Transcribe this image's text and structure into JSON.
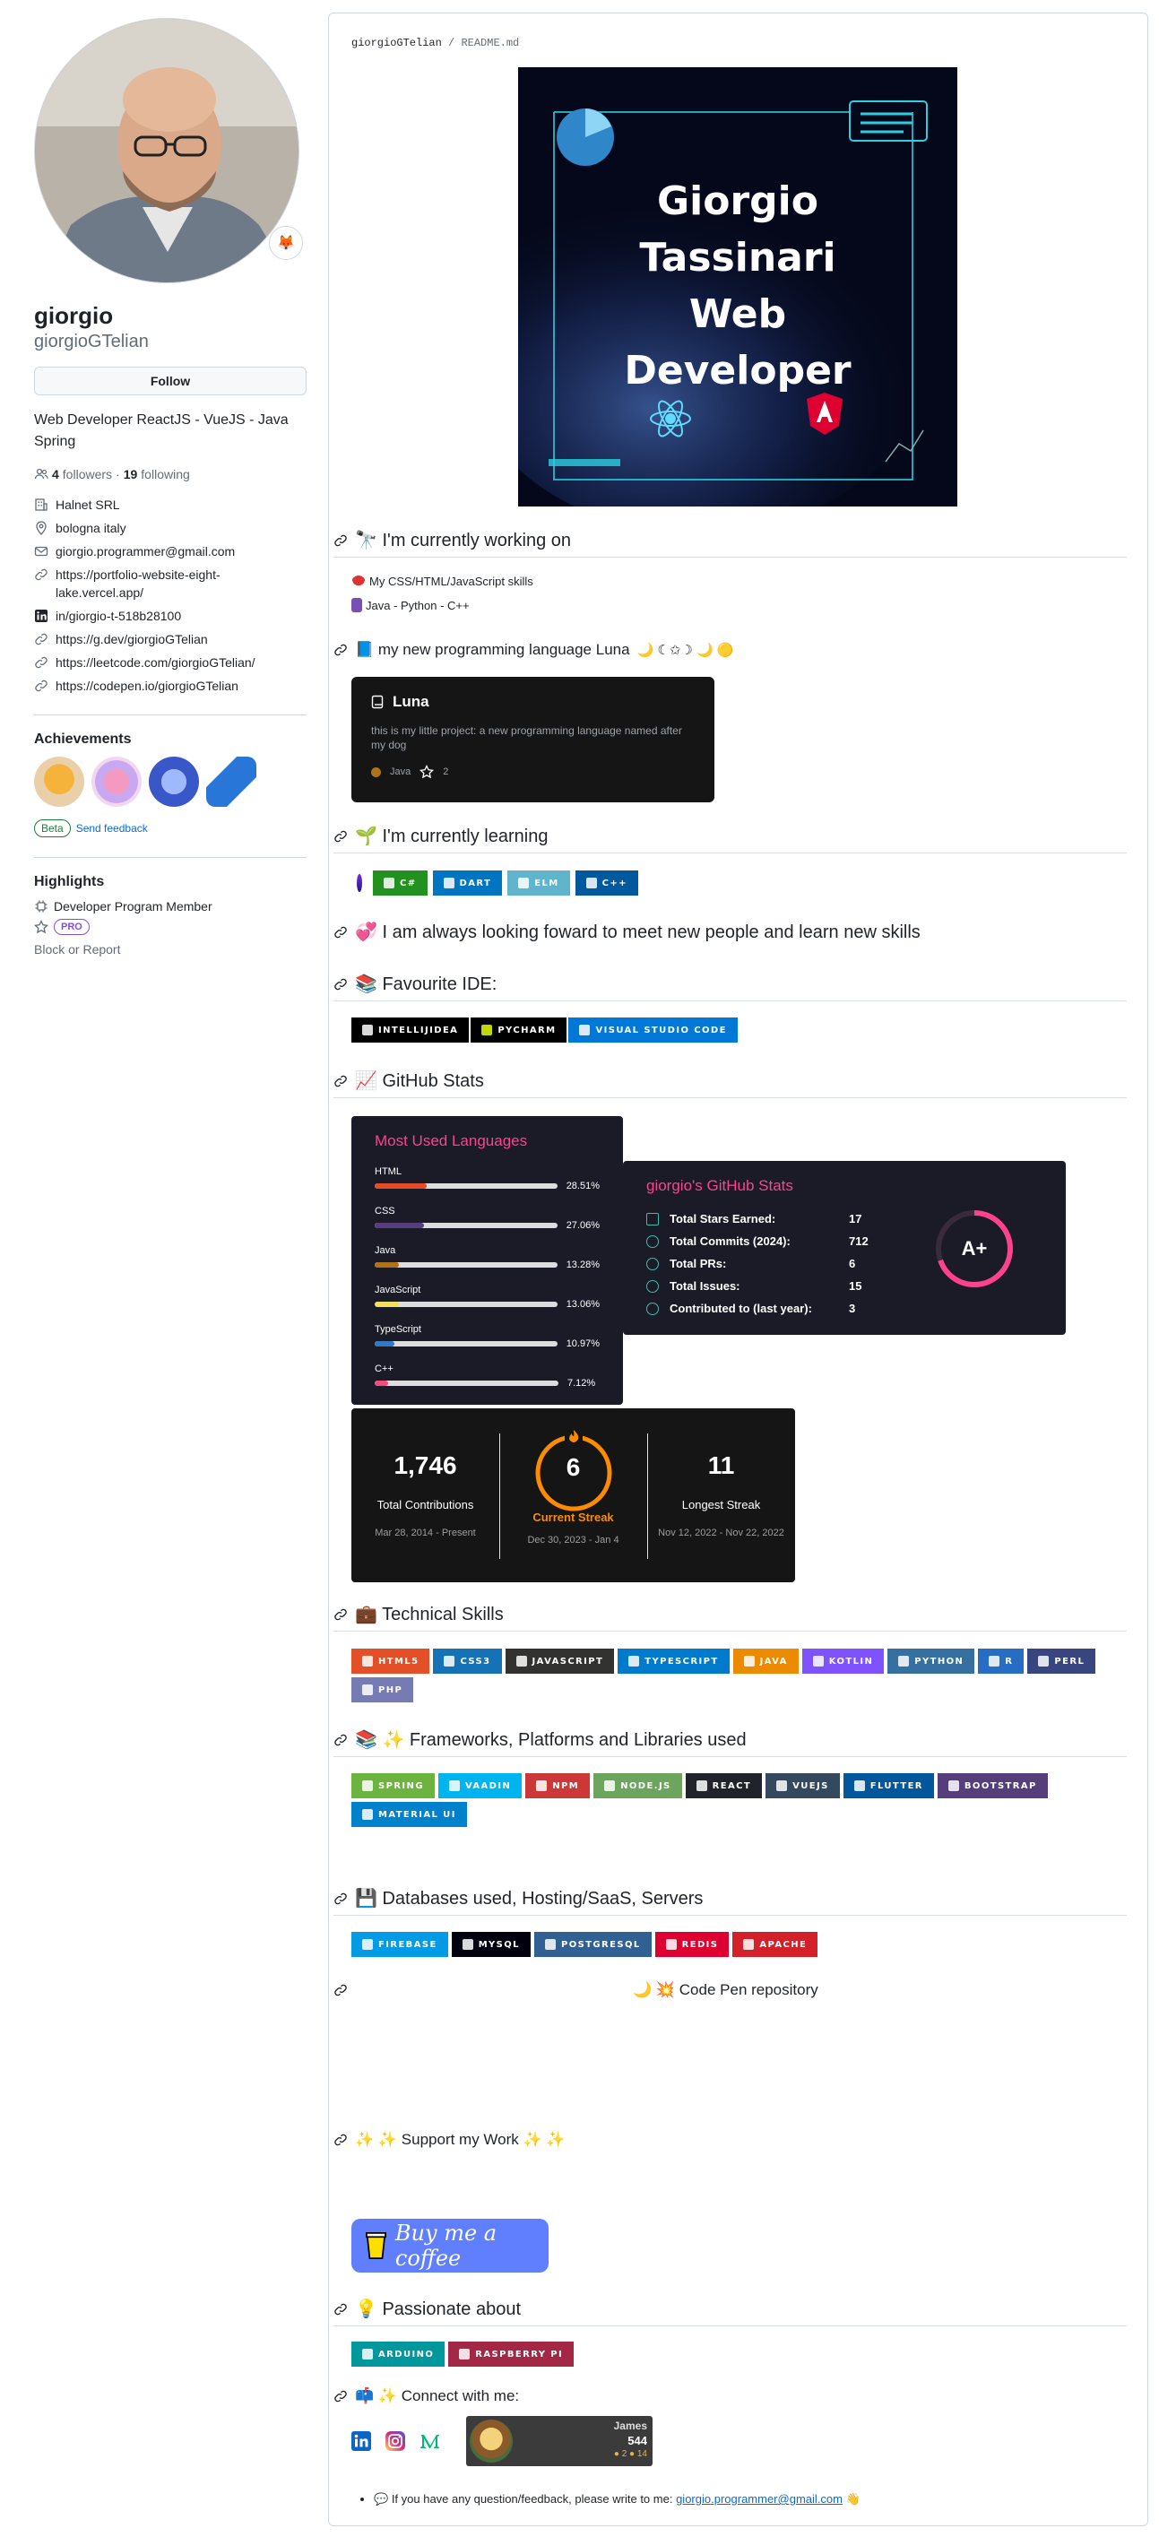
{
  "profile": {
    "name": "giorgio",
    "login": "giorgioGTelian",
    "follow_label": "Follow",
    "bio": "Web Developer ReactJS - VueJS - Java Spring",
    "followers_count": "4",
    "followers_label": "followers",
    "separator": "·",
    "following_count": "19",
    "following_label": "following",
    "status_emoji": "🦊",
    "details": [
      {
        "icon": "organization-icon",
        "text": "Halnet SRL"
      },
      {
        "icon": "location-icon",
        "text": "bologna italy"
      },
      {
        "icon": "mail-icon",
        "text": "giorgio.programmer@gmail.com"
      },
      {
        "icon": "link-icon",
        "text": "https://portfolio-website-eight-lake.vercel.app/"
      },
      {
        "icon": "linkedin-icon",
        "text": "in/giorgio-t-518b28100"
      },
      {
        "icon": "link-icon",
        "text": "https://g.dev/giorgioGTelian"
      },
      {
        "icon": "link-icon",
        "text": "https://leetcode.com/giorgioGTelian/"
      },
      {
        "icon": "link-icon",
        "text": "https://codepen.io/giorgioGTelian"
      }
    ],
    "achievements_title": "Achievements",
    "beta_label": "Beta",
    "feedback_label": "Send feedback",
    "highlights_title": "Highlights",
    "highlight_member": "Developer Program Member",
    "pro_label": "PRO",
    "block_label": "Block or Report"
  },
  "readme": {
    "path_user": "giorgioGTelian",
    "path_sep": " / ",
    "path_file": "README.md",
    "banner_lines": [
      "Giorgio",
      "Tassinari",
      "Web",
      "Developer"
    ],
    "sections": {
      "working": "🔭 I'm currently working on",
      "working_items": [
        "My CSS/HTML/JavaScript skills",
        "Java - Python - C++"
      ],
      "luna": "📘 my new programming language Luna",
      "luna_suffix": "🌙 ☾✩☽ 🌙 🟡",
      "learning": "🌱 I'm currently learning",
      "meet": "💞️ I am always looking foward to meet new people and learn new skills",
      "ide": "📚 Favourite IDE:",
      "stats": "📈 GitHub Stats",
      "skills": "💼 Technical Skills",
      "frameworks": "📚 ✨ Frameworks, Platforms and Libraries used",
      "databases": "💾 Databases used, Hosting/SaaS, Servers",
      "codepen": "🌙 💥 Code Pen repository",
      "support": "✨ ✨ Support my Work ✨ ✨",
      "passionate": "💡 Passionate about",
      "connect": "📫 ✨ Connect with me:"
    },
    "luna_card": {
      "title": "Luna",
      "desc": "this is my little project: a new programming language named after my dog",
      "lang": "Java",
      "stars": "2"
    },
    "learning_badges": [
      {
        "label": "C#",
        "color": "#239120"
      },
      {
        "label": "DART",
        "color": "#0175C2"
      },
      {
        "label": "ELM",
        "color": "#60B5CC"
      },
      {
        "label": "C++",
        "color": "#00599C"
      }
    ],
    "ide_badges": [
      {
        "label": "INTELLIJIDEA",
        "color": "#000000"
      },
      {
        "label": "PYCHARM",
        "color": "#000000"
      },
      {
        "label": "VISUAL STUDIO CODE",
        "color": "#0078d7"
      }
    ],
    "languages_card": {
      "title": "Most Used Languages",
      "items": [
        {
          "name": "HTML",
          "pct": 28.51,
          "label": "28.51%",
          "color": "#e34c26"
        },
        {
          "name": "CSS",
          "pct": 27.06,
          "label": "27.06%",
          "color": "#563d7c"
        },
        {
          "name": "Java",
          "pct": 13.28,
          "label": "13.28%",
          "color": "#b07219"
        },
        {
          "name": "JavaScript",
          "pct": 13.06,
          "label": "13.06%",
          "color": "#f1e05a"
        },
        {
          "name": "TypeScript",
          "pct": 10.97,
          "label": "10.97%",
          "color": "#3178c6"
        },
        {
          "name": "C++",
          "pct": 7.12,
          "label": "7.12%",
          "color": "#f34b7d"
        }
      ]
    },
    "stats_card": {
      "title": "giorgio's GitHub Stats",
      "rows": [
        {
          "label": "Total Stars Earned:",
          "value": "17"
        },
        {
          "label": "Total Commits (2024):",
          "value": "712"
        },
        {
          "label": "Total PRs:",
          "value": "6"
        },
        {
          "label": "Total Issues:",
          "value": "15"
        },
        {
          "label": "Contributed to (last year):",
          "value": "3"
        }
      ],
      "grade": "A+"
    },
    "streak_card": {
      "total": "1,746",
      "total_label": "Total Contributions",
      "total_range": "Mar 28, 2014 - Present",
      "current": "6",
      "current_label": "Current Streak",
      "current_range": "Dec 30, 2023 - Jan 4",
      "longest": "11",
      "longest_label": "Longest Streak",
      "longest_range": "Nov 12, 2022 - Nov 22, 2022"
    },
    "skill_badges": [
      {
        "label": "HTML5",
        "color": "#E34F26"
      },
      {
        "label": "CSS3",
        "color": "#1572B6"
      },
      {
        "label": "JAVASCRIPT",
        "color": "#323330"
      },
      {
        "label": "TYPESCRIPT",
        "color": "#007ACC"
      },
      {
        "label": "JAVA",
        "color": "#ED8B00"
      },
      {
        "label": "KOTLIN",
        "color": "#7F52FF"
      },
      {
        "label": "PYTHON",
        "color": "#3670A0"
      },
      {
        "label": "R",
        "color": "#276DC3"
      },
      {
        "label": "PERL",
        "color": "#39457E"
      },
      {
        "label": "PHP",
        "color": "#777BB4"
      }
    ],
    "framework_badges": [
      {
        "label": "SPRING",
        "color": "#6DB33F"
      },
      {
        "label": "VAADIN",
        "color": "#00B4F0"
      },
      {
        "label": "NPM",
        "color": "#CB3837"
      },
      {
        "label": "NODE.JS",
        "color": "#6DA55F"
      },
      {
        "label": "REACT",
        "color": "#20232a"
      },
      {
        "label": "VUEJS",
        "color": "#35495e"
      },
      {
        "label": "FLUTTER",
        "color": "#02569B"
      },
      {
        "label": "BOOTSTRAP",
        "color": "#563D7C"
      },
      {
        "label": "MATERIAL UI",
        "color": "#0081CB"
      }
    ],
    "database_badges": [
      {
        "label": "FIREBASE",
        "color": "#039BE5"
      },
      {
        "label": "MYSQL",
        "color": "#00000f"
      },
      {
        "label": "POSTGRESQL",
        "color": "#316192"
      },
      {
        "label": "REDIS",
        "color": "#DD0031"
      },
      {
        "label": "APACHE",
        "color": "#D42029"
      }
    ],
    "passion_badges": [
      {
        "label": "ARDUINO",
        "color": "#00979D"
      },
      {
        "label": "RASPBERRY PI",
        "color": "#A22846"
      }
    ],
    "coffee_label": "Buy me a coffee",
    "leetcode_card": {
      "name": "James",
      "score": "544",
      "stats": "● 2 ● 14"
    },
    "footer_text": "If you have any question/feedback, please write to me:",
    "footer_email": "giorgio.programmer@gmail.com",
    "footer_end": "👋"
  }
}
